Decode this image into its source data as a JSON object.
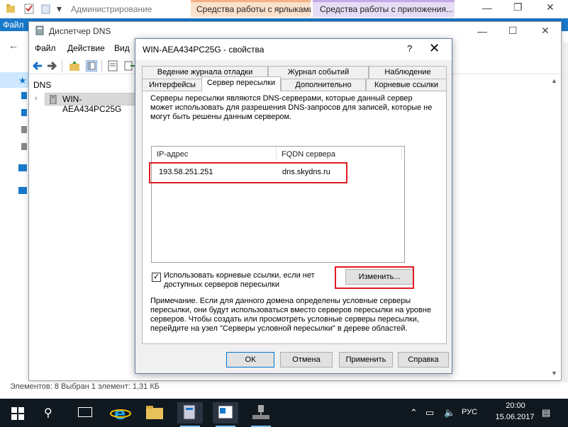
{
  "server_manager": {
    "title": "Администрирование",
    "ribbon_file": "Файл",
    "context_tab_1": "Средства работы с ярлыками",
    "context_tab_2": "Средства работы с приложения...",
    "status_text": "Элементов: 8    Выбран 1 элемент: 1,31 КБ"
  },
  "dns_manager": {
    "title": "Диспетчер DNS",
    "menu": [
      "Файл",
      "Действие",
      "Вид"
    ],
    "tree": {
      "root": "DNS",
      "server": "WIN-AEA434PC25G"
    }
  },
  "dialog": {
    "title": "WIN-AEA434PC25G - свойства",
    "help_glyph": "?",
    "close_glyph": "✕",
    "tabs_row1": [
      "Ведение журнала отладки",
      "Журнал событий",
      "Наблюдение"
    ],
    "tabs_row2": [
      "Интерфейсы",
      "Сервер пересылки",
      "Дополнительно",
      "Корневые ссылки"
    ],
    "active_tab": "Сервер пересылки",
    "description": "Серверы пересылки являются DNS-серверами, которые данный сервер может использовать для разрешения DNS-запросов для записей, которые не могут быть решены данным сервером.",
    "list": {
      "columns": [
        "IP-адрес",
        "FQDN сервера"
      ],
      "rows": [
        {
          "ip": "193.58.251.251",
          "fqdn": "dns.skydns.ru"
        }
      ]
    },
    "use_root_hints": {
      "checked": true,
      "label": "Использовать корневые ссылки, если нет доступных серверов пересылки"
    },
    "edit_button": "Изменить...",
    "note": "Примечание. Если для данного домена определены условные серверы пересылки, они будут использоваться вместо серверов пересылки на уровне серверов.  Чтобы создать или просмотреть условные серверы пересылки, перейдите на узел \"Серверы условной пересылки\" в дереве областей.",
    "buttons": {
      "ok": "ОК",
      "cancel": "Отмена",
      "apply": "Применить",
      "help": "Справка"
    }
  },
  "taskbar": {
    "language": "РУС",
    "time": "20:00",
    "date": "15.06.2017"
  },
  "colors": {
    "highlight": "#e01b24",
    "ribbon_blue": "#1979ca",
    "taskbar": "#101820"
  }
}
